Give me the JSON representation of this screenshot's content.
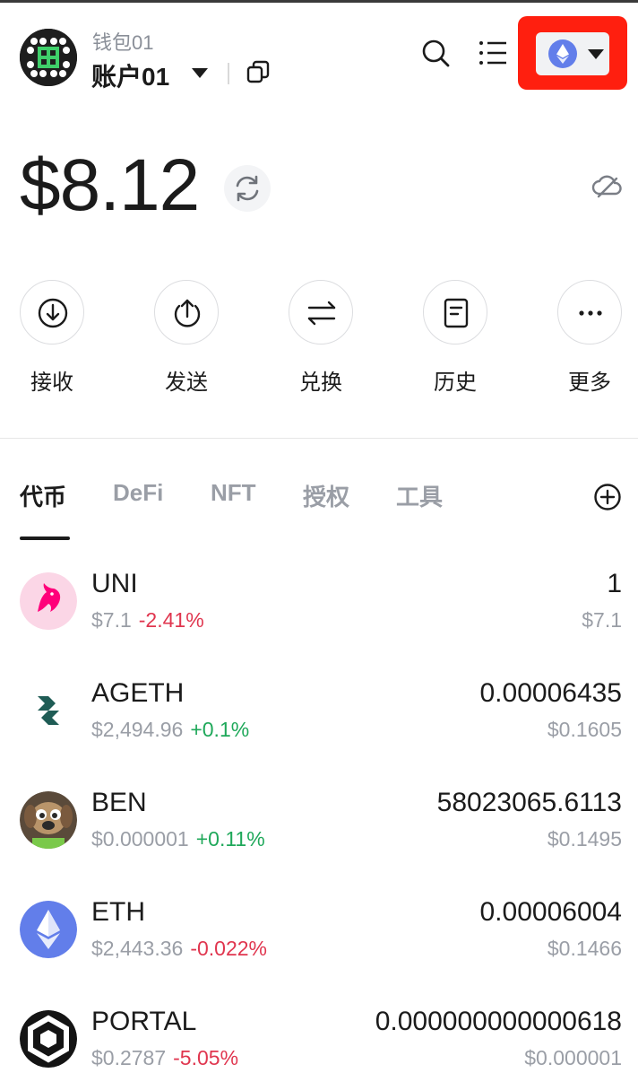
{
  "header": {
    "wallet_name": "钱包01",
    "account_name": "账户01",
    "network_icon": "ethereum-icon"
  },
  "balance": {
    "value": "$8.12"
  },
  "actions": [
    {
      "label": "接收",
      "icon": "receive-icon"
    },
    {
      "label": "发送",
      "icon": "send-icon"
    },
    {
      "label": "兑换",
      "icon": "swap-icon"
    },
    {
      "label": "历史",
      "icon": "history-icon"
    },
    {
      "label": "更多",
      "icon": "more-icon"
    }
  ],
  "tabs": [
    {
      "label": "代币",
      "active": true
    },
    {
      "label": "DeFi",
      "active": false
    },
    {
      "label": "NFT",
      "active": false
    },
    {
      "label": "授权",
      "active": false
    },
    {
      "label": "工具",
      "active": false
    }
  ],
  "tokens": [
    {
      "symbol": "UNI",
      "price": "$7.1",
      "change": "-2.41%",
      "amount": "1",
      "value": "$7.1"
    },
    {
      "symbol": "AGETH",
      "price": "$2,494.96",
      "change": "+0.1%",
      "amount": "0.00006435",
      "value": "$0.1605"
    },
    {
      "symbol": "BEN",
      "price": "$0.000001",
      "change": "+0.11%",
      "amount": "58023065.6113",
      "value": "$0.1495"
    },
    {
      "symbol": "ETH",
      "price": "$2,443.36",
      "change": "-0.022%",
      "amount": "0.00006004",
      "value": "$0.1466"
    },
    {
      "symbol": "PORTAL",
      "price": "$0.2787",
      "change": "-5.05%",
      "amount": "0.000000000000618",
      "value": "$0.000001"
    }
  ],
  "colors": {
    "negative": "#e0364f",
    "positive": "#1fa85a",
    "highlight": "#ff1f0f",
    "eth": "#627eea"
  }
}
